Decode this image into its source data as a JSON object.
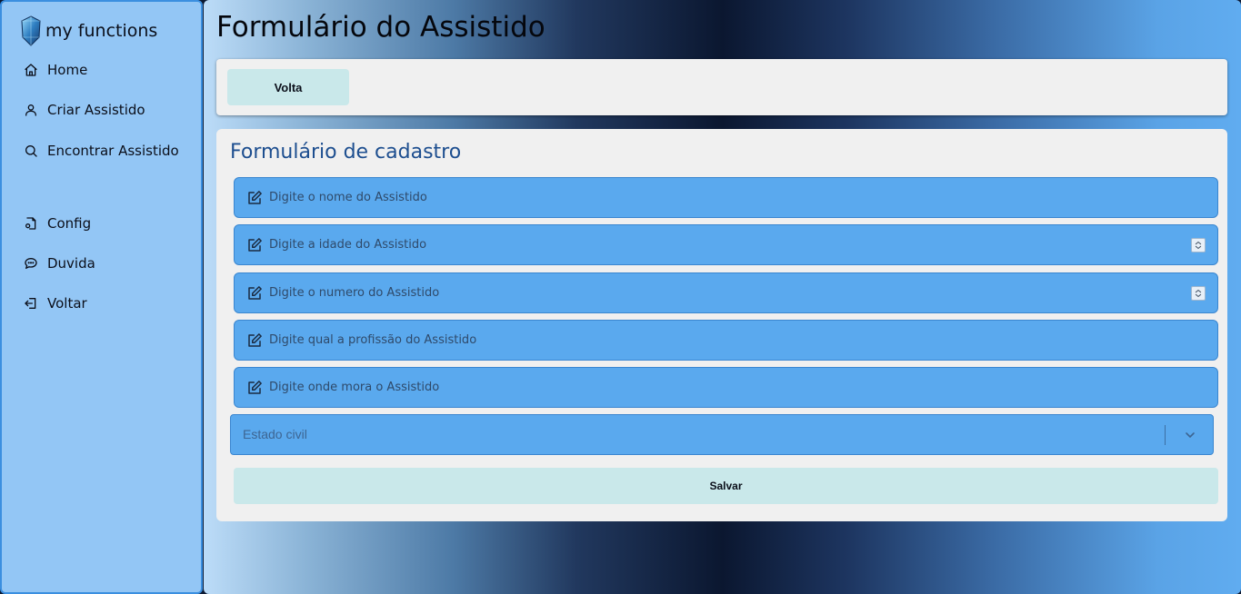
{
  "brand": {
    "name": "my functions"
  },
  "sidebar": {
    "items": [
      {
        "label": "Home",
        "icon": "home-icon"
      },
      {
        "label": "Criar Assistido",
        "icon": "user-icon"
      },
      {
        "label": "Encontrar Assistido",
        "icon": "search-icon"
      },
      {
        "label": "Config",
        "icon": "settings-file-icon"
      },
      {
        "label": "Duvida",
        "icon": "chat-icon"
      },
      {
        "label": "Voltar",
        "icon": "logout-icon"
      }
    ]
  },
  "page": {
    "title": "Formulário do Assistido"
  },
  "topbar": {
    "back_label": "Volta"
  },
  "form": {
    "title": "Formulário de cadastro",
    "fields": [
      {
        "placeholder": "Digite o nome do Assistido",
        "value": ""
      },
      {
        "placeholder": "Digite a idade do Assistido",
        "value": ""
      },
      {
        "placeholder": "Digite o numero do Assistido",
        "value": ""
      },
      {
        "placeholder": "Digite qual a profissão do Assistido",
        "value": ""
      },
      {
        "placeholder": "Digite onde mora o Assistido",
        "value": ""
      }
    ],
    "select": {
      "placeholder": "Estado civil"
    },
    "submit_label": "Salvar"
  },
  "colors": {
    "sidebar_bg": "#93c6f5",
    "field_bg": "#5aa9ee",
    "button_bg": "#c9e8ea",
    "form_title": "#1d4e8f"
  }
}
